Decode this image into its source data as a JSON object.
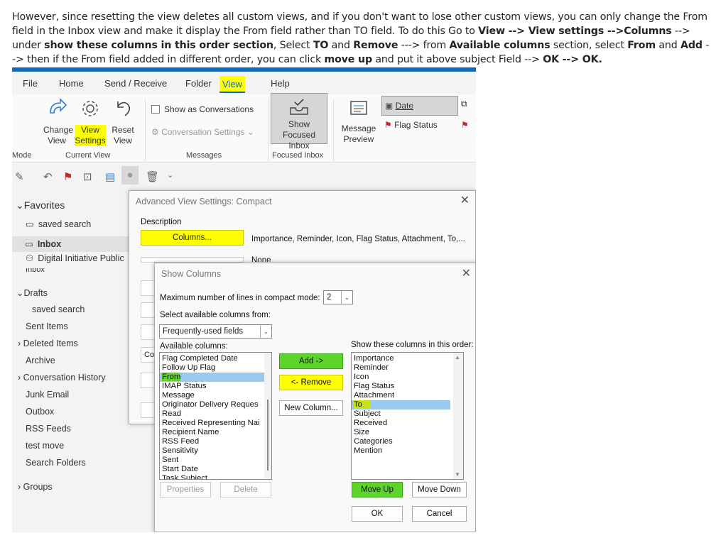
{
  "intro": {
    "p1": "However, since resetting the view deletes all custom views, and if you don't want to lose other custom views, you can only change the From field in the Inbox view and make it display the From field rather than TO field. To do this Go to ",
    "b1": "View --> View settings -->Columns",
    "p2": " --> under ",
    "b2": "show these columns in this order section",
    "p3": ", Select ",
    "b3": "TO",
    "p4": " and ",
    "b4": "Remove",
    "p5": " ---> from ",
    "b5": "Available columns",
    "p6": " section, select ",
    "b6": "From",
    "p7": " and ",
    "b7": "Add",
    "p8": " --> then if the From field added in different order, you can click ",
    "b8": "move up",
    "p9": " and put it above subject Field --> ",
    "b9": "OK --> OK."
  },
  "ribbon": {
    "tabs": [
      "File",
      "Home",
      "Send / Receive",
      "Folder",
      "View",
      "Help"
    ],
    "active_tab": "View",
    "change_view": "Change View",
    "view_settings": "View Settings",
    "reset_view": "Reset View",
    "show_conversations": "Show as Conversations",
    "conversation_settings": "Conversation Settings",
    "show_focused_inbox": "Show Focused Inbox",
    "message_preview": "Message Preview",
    "date": "Date",
    "flag_status": "Flag Status",
    "groups": [
      "Mode",
      "Current View",
      "Messages",
      "Focused Inbox"
    ]
  },
  "nav": {
    "favorites": "Favorites",
    "items": [
      "saved search",
      "Inbox",
      "Digital Initiative Public",
      "Inbox",
      "Drafts",
      "saved search",
      "Sent Items",
      "Deleted Items",
      "Archive",
      "Conversation History",
      "Junk Email",
      "Outbox",
      "RSS Feeds",
      "test move",
      "Search Folders",
      "Groups"
    ]
  },
  "adv_dialog": {
    "title": "Advanced View Settings: Compact",
    "description": "Description",
    "columns_button": "Columns...",
    "columns_value": "Importance, Reminder, Icon, Flag Status, Attachment, To,...",
    "group_by_value": "None"
  },
  "show_columns": {
    "title": "Show Columns",
    "max_lines_label": "Maximum number of lines in compact mode:",
    "max_lines_value": "2",
    "select_from_label": "Select available columns from:",
    "select_from_value": "Frequently-used fields",
    "available_label": "Available columns:",
    "available": [
      "Flag Completed Date",
      "Follow Up Flag",
      "From",
      "IMAP Status",
      "Message",
      "Originator Delivery Reques",
      "Read",
      "Received Representing Nai",
      "Recipient Name",
      "RSS Feed",
      "Sensitivity",
      "Sent",
      "Start Date",
      "Task Subject"
    ],
    "available_selected": "From",
    "add_button": "Add ->",
    "remove_button": "<- Remove",
    "new_column_button": "New Column...",
    "order_label": "Show these columns in this order:",
    "order": [
      "Importance",
      "Reminder",
      "Icon",
      "Flag Status",
      "Attachment",
      "To",
      "Subject",
      "Received",
      "Size",
      "Categories",
      "Mention"
    ],
    "order_selected": "To",
    "properties_button": "Properties",
    "delete_button": "Delete",
    "move_up_button": "Move Up",
    "move_down_button": "Move Down",
    "ok_button": "OK",
    "cancel_button": "Cancel"
  },
  "colors": {
    "accent": "#0f6cbd",
    "highlight_yellow": "#ffff00",
    "highlight_green": "#5ed32a",
    "selection": "#9ac9f0"
  }
}
